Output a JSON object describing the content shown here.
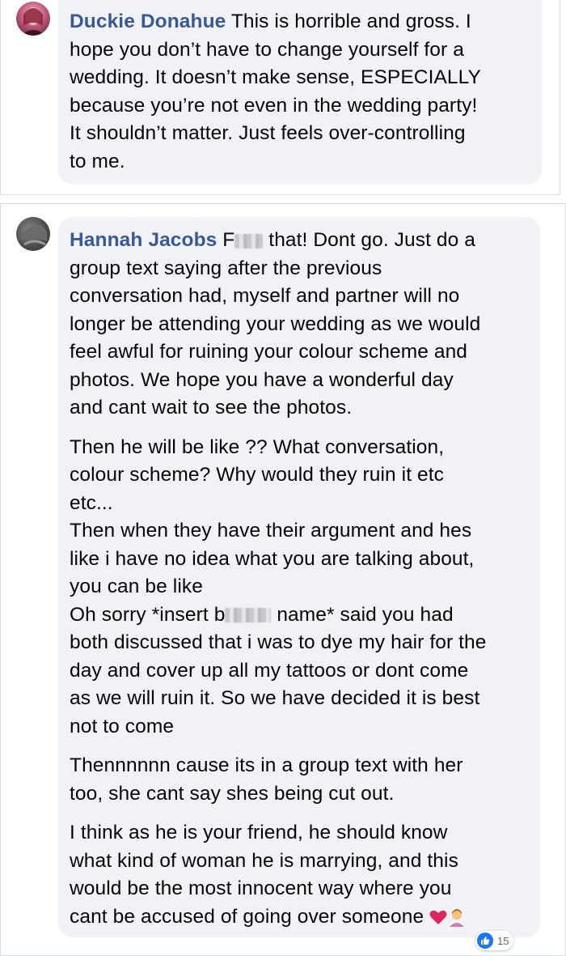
{
  "comments": [
    {
      "author": "Duckie Donahue",
      "lines": [
        " This is horrible and gross. I",
        "hope you don’t have to change yourself for a",
        "wedding. It doesn’t make sense, ESPECIALLY",
        "because you’re not even in the wedding party!",
        "It shouldn’t matter. Just feels over-controlling",
        "to me."
      ]
    },
    {
      "author": "Hannah Jacobs",
      "first_line_start": " F",
      "first_line_end": " that! Dont go. Just do a",
      "para1_lines": [
        "group text saying after the previous",
        "conversation had, myself and partner will no",
        "longer be attending your wedding as we would",
        "feel awful for ruining your colour scheme and",
        "photos. We hope you have a wonderful day",
        "and cant wait to see the photos."
      ],
      "para2_lines": [
        "Then he will be like ?? What conversation,",
        "colour scheme? Why would they ruin it etc",
        "etc...",
        "Then when they have their argument and hes",
        "like i have no idea what you are talking about,",
        "you can be like"
      ],
      "para2_blur_line_start": "Oh sorry *insert b",
      "para2_blur_line_end": " name* said you had",
      "para2_tail_lines": [
        "both discussed that i was to dye my hair for the",
        "day and cover up all my tattoos or dont come",
        "as we will ruin it. So we have decided it is best",
        "not to come"
      ],
      "para3_lines": [
        "Thennnnnn cause its in a group text with her",
        "too, she cant say shes being cut out."
      ],
      "para4_lines": [
        "I think as he is your friend, he should know",
        "what kind of woman he is marrying, and this",
        "would be the most innocent way where you"
      ],
      "para4_last_line": "cant be accused of going over someone ",
      "reactions": {
        "count": "15",
        "icons": [
          "like-icon"
        ]
      }
    }
  ],
  "colors": {
    "author": "#385898",
    "bubble": "#f0f2f5",
    "text": "#050505",
    "like": "#1877f2"
  }
}
